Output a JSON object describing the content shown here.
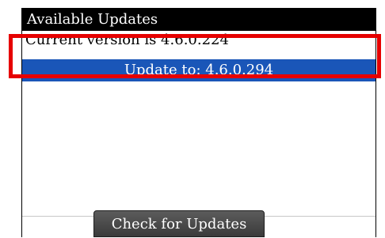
{
  "title": "Available Updates",
  "current_version_text": "Current version is 4.6.0.224",
  "update_item_label": "Update to: 4.6.0.294",
  "check_button_label": "Check for Updates",
  "colors": {
    "titlebar": "#000000",
    "selection": "#1a56b8",
    "highlight_box": "#e60000",
    "button": "#4a4a4a"
  }
}
